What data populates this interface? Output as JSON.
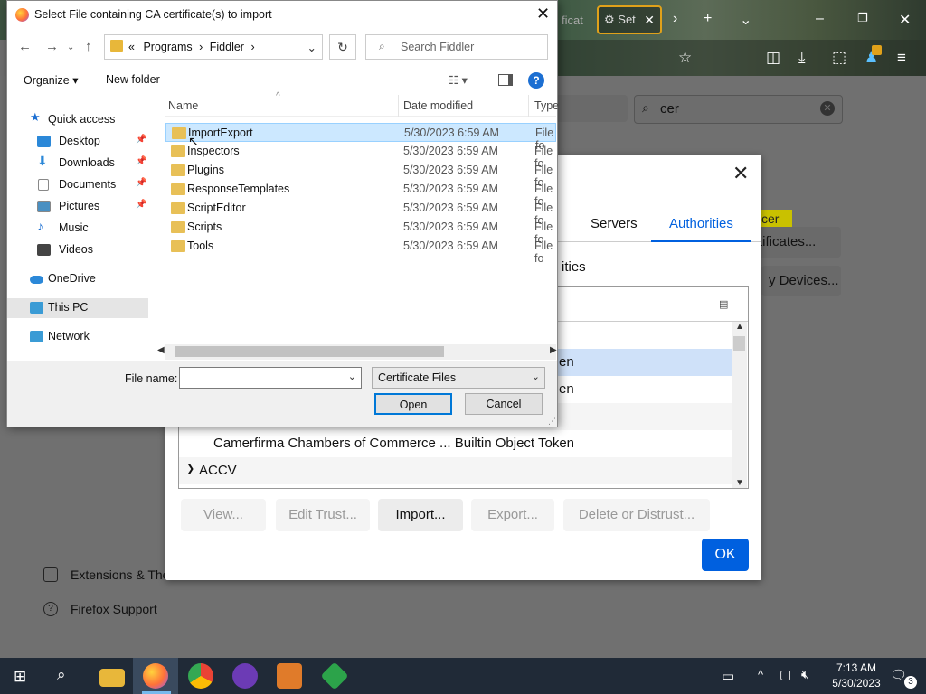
{
  "firefox": {
    "tab_label": "Set",
    "tab_fragment": "ficat",
    "search_value": "cer",
    "sidebar_links": [
      "Extensions & The",
      "Firefox Support"
    ],
    "buttons": [
      "rtificates...",
      "y Devices..."
    ],
    "highlight_word": "cer"
  },
  "cert_dialog": {
    "tabs": [
      "Servers",
      "Authorities"
    ],
    "subtitle": "ities",
    "rows": [
      "en",
      "en",
      "Camerfirma Chambers of Commerce ... Builtin Object Token"
    ],
    "group": "ACCV",
    "buttons": {
      "view": "View...",
      "edit_trust": "Edit Trust...",
      "import": "Import...",
      "export": "Export...",
      "delete": "Delete or Distrust...",
      "ok": "OK"
    }
  },
  "file_dialog": {
    "title": "Select File containing CA certificate(s) to import",
    "path": [
      "«",
      "Programs",
      "›",
      "Fiddler",
      "›"
    ],
    "search_placeholder": "Search Fiddler",
    "toolbar": {
      "organize": "Organize ▾",
      "new_folder": "New folder"
    },
    "nav": [
      {
        "label": "Quick access",
        "color": "#1c6fd2"
      },
      {
        "label": "Desktop",
        "color": "#2b88d8"
      },
      {
        "label": "Downloads",
        "color": "#2b88d8"
      },
      {
        "label": "Documents",
        "color": "#8a8a8a"
      },
      {
        "label": "Pictures",
        "color": "#4a90c2"
      },
      {
        "label": "Music",
        "color": "#1c6fd2"
      },
      {
        "label": "Videos",
        "color": "#444"
      },
      {
        "label": "OneDrive",
        "color": "#2b88d8"
      },
      {
        "label": "This PC",
        "color": "#3a9bd5"
      },
      {
        "label": "Network",
        "color": "#3a9bd5"
      }
    ],
    "columns": {
      "name": "Name",
      "date": "Date modified",
      "type": "Type"
    },
    "files": [
      {
        "name": "ImportExport",
        "date": "5/30/2023 6:59 AM",
        "type": "File fo"
      },
      {
        "name": "Inspectors",
        "date": "5/30/2023 6:59 AM",
        "type": "File fo"
      },
      {
        "name": "Plugins",
        "date": "5/30/2023 6:59 AM",
        "type": "File fo"
      },
      {
        "name": "ResponseTemplates",
        "date": "5/30/2023 6:59 AM",
        "type": "File fo"
      },
      {
        "name": "ScriptEditor",
        "date": "5/30/2023 6:59 AM",
        "type": "File fo"
      },
      {
        "name": "Scripts",
        "date": "5/30/2023 6:59 AM",
        "type": "File fo"
      },
      {
        "name": "Tools",
        "date": "5/30/2023 6:59 AM",
        "type": "File fo"
      }
    ],
    "file_name_label": "File name:",
    "file_name_value": "",
    "filter": "Certificate Files",
    "open": "Open",
    "cancel": "Cancel"
  },
  "taskbar": {
    "time": "7:13 AM",
    "date": "5/30/2023",
    "notification_count": "3"
  }
}
